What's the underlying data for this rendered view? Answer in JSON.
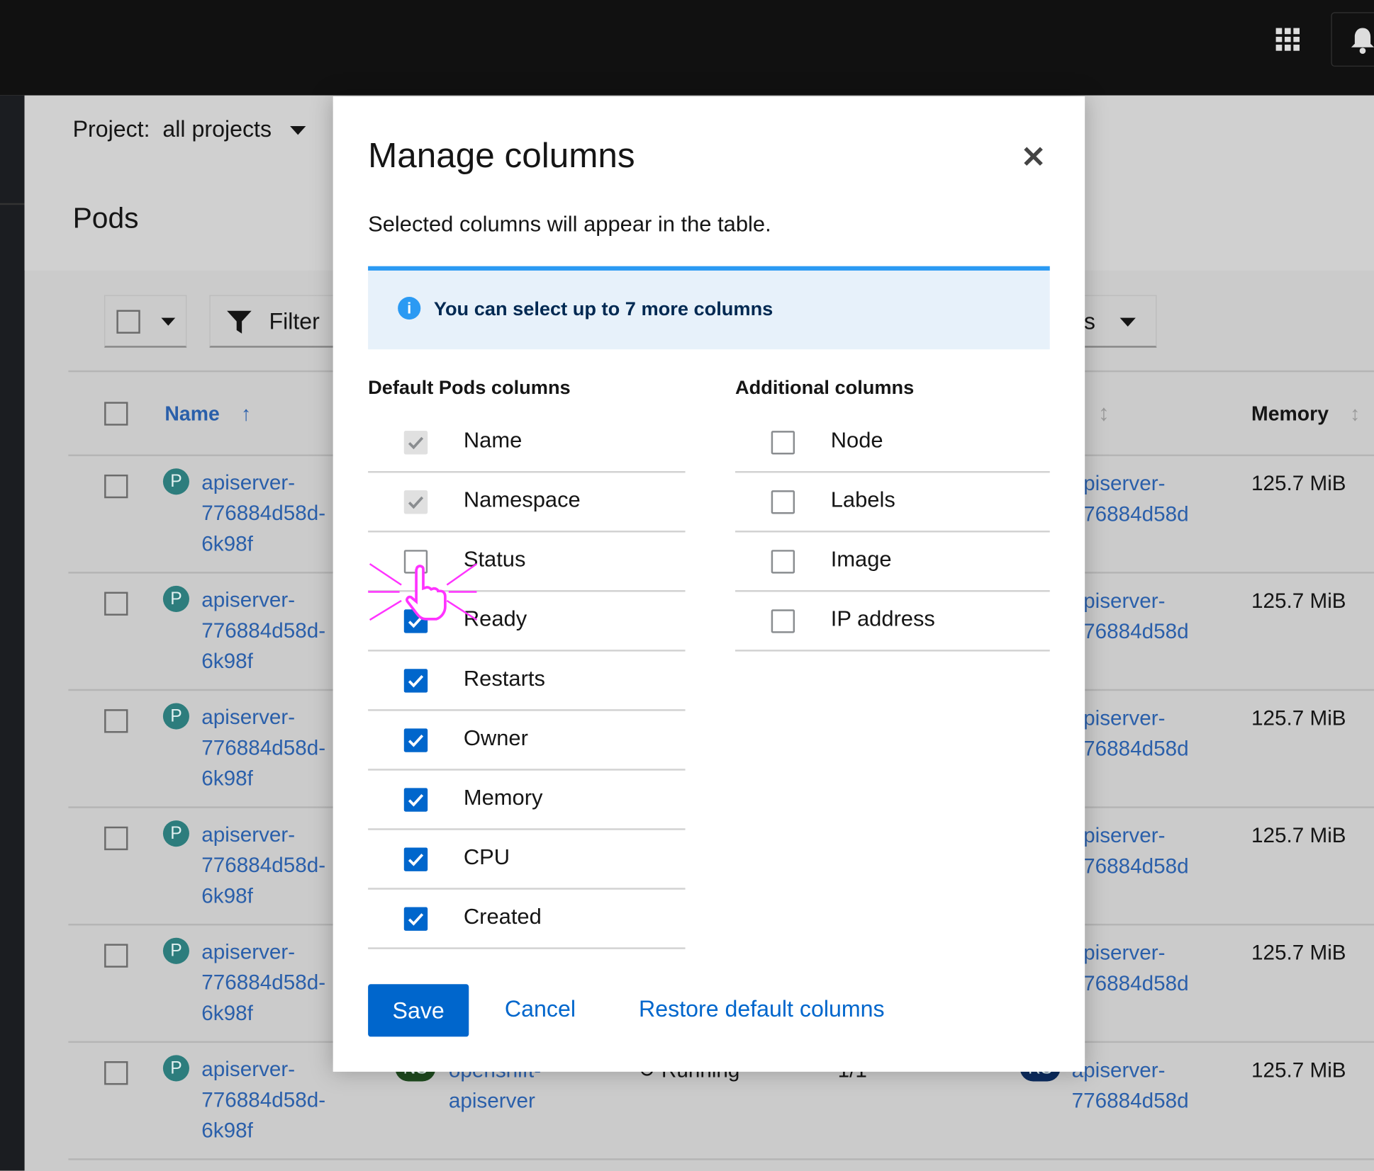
{
  "masthead": {
    "apps_icon": "grid-icon",
    "notification_icon": "bell-icon"
  },
  "page": {
    "project_label": "Project:",
    "project_value": "all projects",
    "title": "Pods",
    "filter_label": "Filter",
    "dropdown_label": "s"
  },
  "table": {
    "headers": {
      "name": "Name",
      "memory": "Memory"
    },
    "rows": [
      {
        "badge": "P",
        "name1": "apiserver-",
        "name2": "776884d58d-",
        "name3": "6k98f",
        "owner1": "apiserver-",
        "owner2": "776884d58d",
        "memory": "125.7 MiB"
      },
      {
        "badge": "P",
        "name1": "apiserver-",
        "name2": "776884d58d-",
        "name3": "6k98f",
        "owner1": "apiserver-",
        "owner2": "776884d58d",
        "memory": "125.7 MiB"
      },
      {
        "badge": "P",
        "name1": "apiserver-",
        "name2": "776884d58d-",
        "name3": "6k98f",
        "owner1": "apiserver-",
        "owner2": "776884d58d",
        "memory": "125.7 MiB"
      },
      {
        "badge": "P",
        "name1": "apiserver-",
        "name2": "776884d58d-",
        "name3": "6k98f",
        "owner1": "apiserver-",
        "owner2": "776884d58d",
        "memory": "125.7 MiB"
      },
      {
        "badge": "P",
        "name1": "apiserver-",
        "name2": "776884d58d-",
        "name3": "6k98f",
        "owner1": "apiserver-",
        "owner2": "776884d58d",
        "memory": "125.7 MiB"
      },
      {
        "badge": "P",
        "name1": "apiserver-",
        "name2": "776884d58d-",
        "name3": "6k98f",
        "owner1": "apiserver-",
        "owner2": "776884d58d",
        "memory": "125.7 MiB",
        "ns_badge": "NS",
        "ns1": "openshift-",
        "ns2": "apiserver",
        "status": "Running",
        "ready": "1/1",
        "owner_badge": "RS"
      }
    ]
  },
  "modal": {
    "title": "Manage columns",
    "description": "Selected columns will appear in the table.",
    "alert": "You can select up to 7 more columns",
    "default_heading": "Default Pods columns",
    "additional_heading": "Additional columns",
    "default_columns": [
      {
        "label": "Name",
        "state": "disabled-checked"
      },
      {
        "label": "Namespace",
        "state": "disabled-checked"
      },
      {
        "label": "Status",
        "state": "unchecked"
      },
      {
        "label": "Ready",
        "state": "checked"
      },
      {
        "label": "Restarts",
        "state": "checked"
      },
      {
        "label": "Owner",
        "state": "checked"
      },
      {
        "label": "Memory",
        "state": "checked"
      },
      {
        "label": "CPU",
        "state": "checked"
      },
      {
        "label": "Created",
        "state": "checked"
      }
    ],
    "additional_columns": [
      {
        "label": "Node",
        "state": "unchecked"
      },
      {
        "label": "Labels",
        "state": "unchecked"
      },
      {
        "label": "Image",
        "state": "unchecked"
      },
      {
        "label": "IP address",
        "state": "unchecked"
      }
    ],
    "save": "Save",
    "cancel": "Cancel",
    "restore": "Restore default columns"
  },
  "colors": {
    "primary": "#0066cc",
    "alert_border": "#2b9af3",
    "alert_bg": "#e7f1fa",
    "cursor_highlight": "#ff33ff"
  }
}
